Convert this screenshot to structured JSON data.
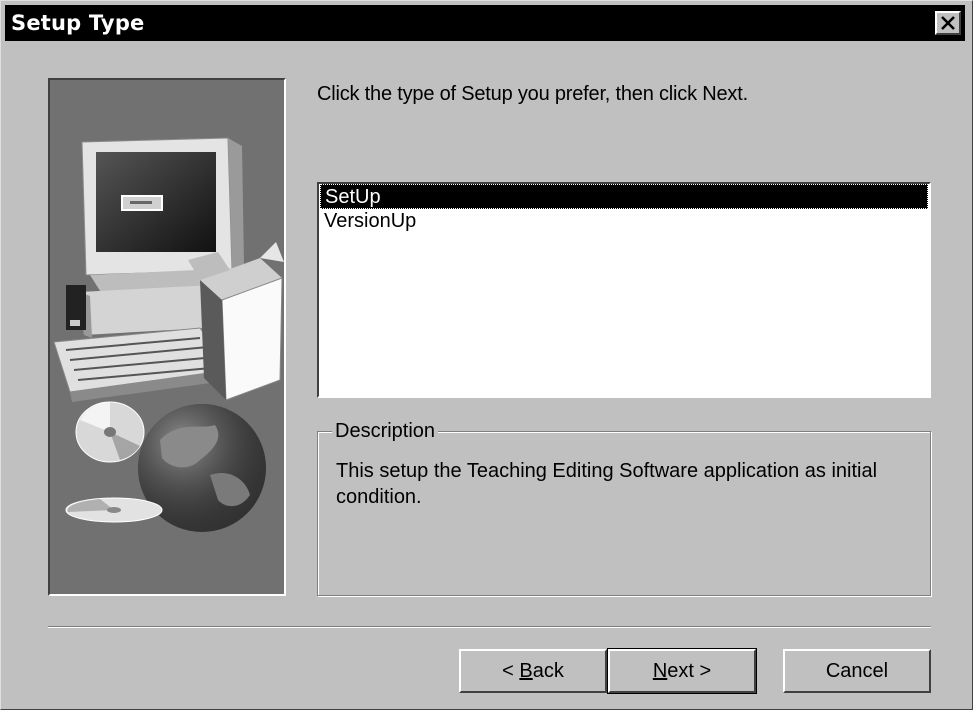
{
  "window": {
    "title": "Setup Type"
  },
  "instruction": "Click the type of Setup you prefer, then click Next.",
  "setup_types": {
    "items": [
      {
        "label": "SetUp",
        "selected": true
      },
      {
        "label": "VersionUp",
        "selected": false
      }
    ]
  },
  "description": {
    "label": "Description",
    "text": "This setup the Teaching Editing Software application as initial condition."
  },
  "buttons": {
    "back": {
      "prefix": "< ",
      "accel": "B",
      "rest": "ack"
    },
    "next": {
      "accel": "N",
      "rest": "ext >"
    },
    "cancel": "Cancel"
  }
}
